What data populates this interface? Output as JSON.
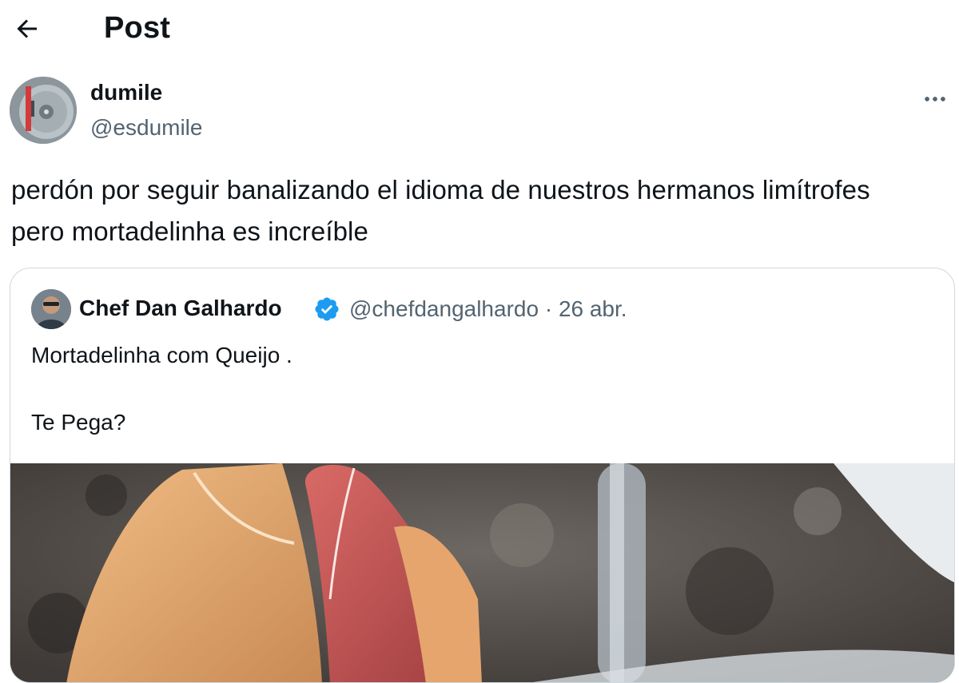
{
  "header": {
    "title": "Post",
    "back_icon": "arrow-left-icon"
  },
  "author": {
    "name": "dumile",
    "handle": "@esdumile",
    "more_icon": "more-horizontal-icon"
  },
  "post": {
    "text": "perdón por seguir banalizando el idioma de nuestros hermanos limítrofes pero mortadelinha es increíble"
  },
  "quote": {
    "name": "Chef Dan Galhardo",
    "verified_icon": "verified-badge-icon",
    "verified_color": "#1d9bf0",
    "handle": "@chefdangalhardo",
    "separator": "·",
    "date": "26 abr.",
    "text_lines": [
      "Mortadelinha com Queijo .",
      "",
      "Te Pega?"
    ]
  },
  "colors": {
    "text": "#0f1419",
    "secondary": "#536471",
    "border": "#cfd9de"
  }
}
